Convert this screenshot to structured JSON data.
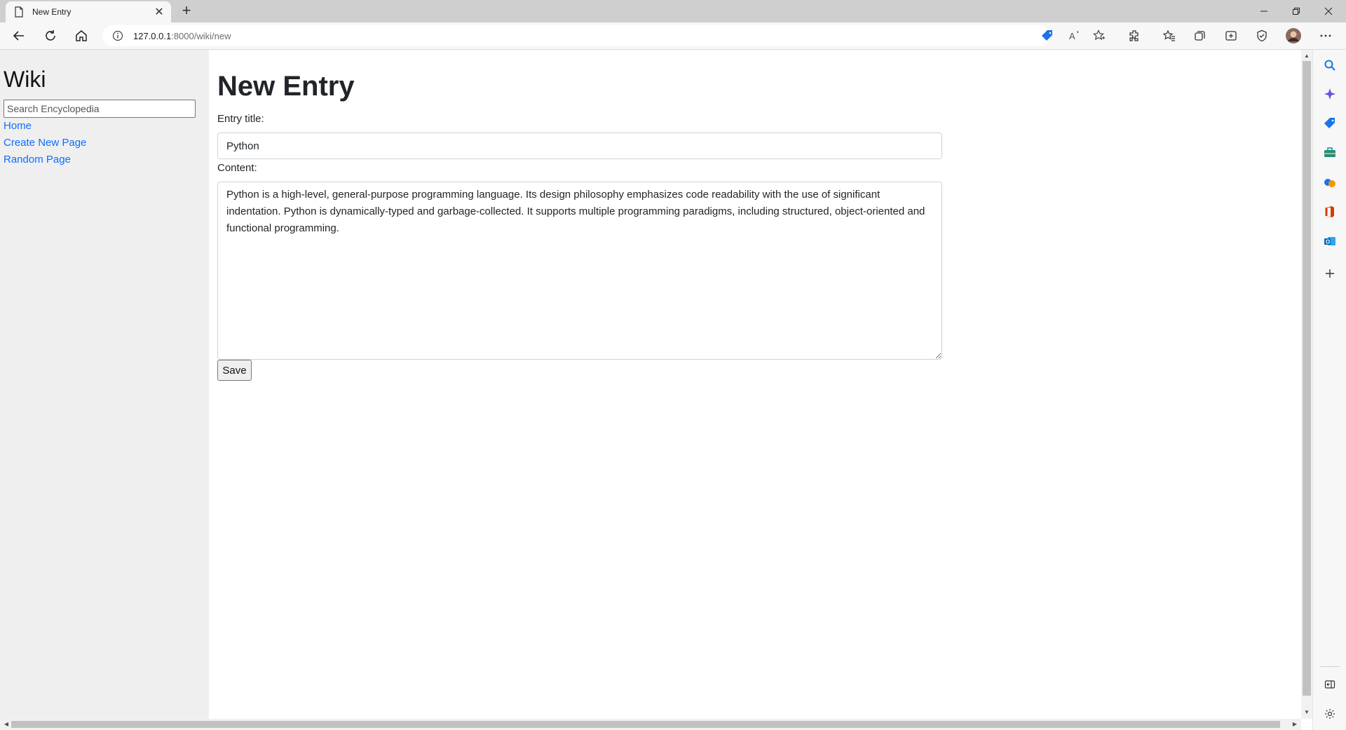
{
  "browser": {
    "tab_title": "New Entry",
    "new_tab_symbol": "+",
    "url_host": "127.0.0.1",
    "url_path": ":8000/wiki/new"
  },
  "sidebar": {
    "title": "Wiki",
    "search_placeholder": "Search Encyclopedia",
    "links": [
      {
        "label": "Home"
      },
      {
        "label": "Create New Page"
      },
      {
        "label": "Random Page"
      }
    ]
  },
  "main": {
    "heading": "New Entry",
    "title_label": "Entry title:",
    "title_value": "Python",
    "content_label": "Content:",
    "content_value": "Python is a high-level, general-purpose programming language. Its design philosophy emphasizes code readability with the use of significant indentation. Python is dynamically-typed and garbage-collected. It supports multiple programming paradigms, including structured, object-oriented and functional programming.",
    "save_label": "Save"
  },
  "colors": {
    "link": "#0d6efd",
    "sidebar_bg": "#efefef",
    "accent": "#0f6cbd"
  }
}
